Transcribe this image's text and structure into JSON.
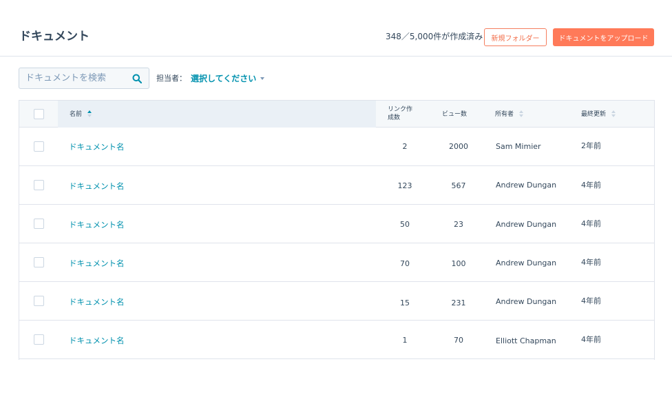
{
  "header": {
    "title": "ドキュメント",
    "count_text": "348／5,000件が作成済み",
    "new_folder_label": "新規フォルダー",
    "upload_label": "ドキュメントをアップロード"
  },
  "filters": {
    "search_placeholder": "ドキュメントを検索",
    "owner_label": "担当者：",
    "owner_select_value": "選択してください"
  },
  "table": {
    "columns": {
      "name": "名前",
      "links_line1": "リンク作",
      "links_line2": "成数",
      "views": "ビュー数",
      "owner": "所有者",
      "updated": "最終更新"
    },
    "rows": [
      {
        "name": "ドキュメント名",
        "links": "2",
        "views": "2000",
        "owner": "Sam Mimier",
        "updated": "2年前"
      },
      {
        "name": "ドキュメント名",
        "links": "123",
        "views": "567",
        "owner": "Andrew Dungan",
        "updated": "4年前"
      },
      {
        "name": "ドキュメント名",
        "links": "50",
        "views": "23",
        "owner": "Andrew Dungan",
        "updated": "4年前"
      },
      {
        "name": "ドキュメント名",
        "links": "70",
        "views": "100",
        "owner": "Andrew Dungan",
        "updated": "4年前"
      },
      {
        "name": "ドキュメント名",
        "links": "15",
        "views": "231",
        "owner": "Andrew Dungan",
        "updated": "4年前"
      },
      {
        "name": "ドキュメント名",
        "links": "1",
        "views": "70",
        "owner": "Elliott Chapman",
        "updated": "4年前"
      }
    ]
  },
  "colors": {
    "accent_orange": "#ff7a59",
    "link_teal": "#0091ae",
    "text_dark": "#33475b"
  },
  "icons": {
    "search": "search-icon",
    "caret": "caret-down-icon",
    "sort_asc": "sort-ascending-icon",
    "sort": "sort-icon"
  }
}
